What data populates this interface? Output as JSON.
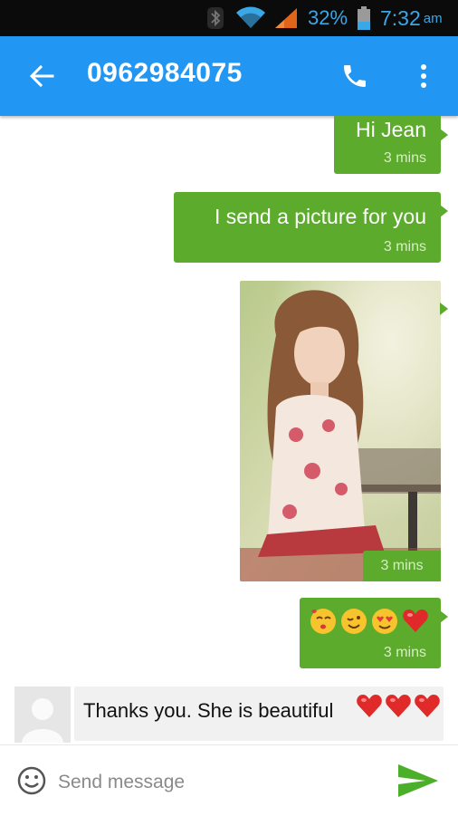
{
  "status_bar": {
    "battery_percent": "32%",
    "time": "7:32",
    "ampm": "am",
    "icons": [
      "bluetooth-icon",
      "wifi-icon",
      "signal-icon",
      "battery-icon"
    ]
  },
  "app_bar": {
    "title": "0962984075",
    "icons": [
      "back-arrow-icon",
      "phone-icon",
      "more-vert-icon"
    ],
    "color": "#2196f3"
  },
  "messages": [
    {
      "direction": "outgoing",
      "text": "Hi Jean",
      "time": "3 mins"
    },
    {
      "direction": "outgoing",
      "text": "I send a picture for you",
      "time": "3 mins"
    },
    {
      "direction": "outgoing",
      "type": "image",
      "image": "photo of a young woman sitting outdoors",
      "time": "3 mins"
    },
    {
      "direction": "outgoing",
      "type": "emoji",
      "emoji": [
        "kiss-emoji",
        "wink-emoji",
        "heart-eyes-emoji",
        "heart-emoji"
      ],
      "time": "3 mins"
    },
    {
      "direction": "incoming",
      "text": "Thanks you. She is beautiful",
      "emoji": [
        "heart-emoji",
        "heart-emoji",
        "heart-emoji"
      ]
    }
  ],
  "composer": {
    "placeholder": "Send message"
  },
  "colors": {
    "outgoing_bubble": "#5cab2d",
    "incoming_bubble": "#f1f1f1",
    "send_icon": "#4caf2a"
  }
}
